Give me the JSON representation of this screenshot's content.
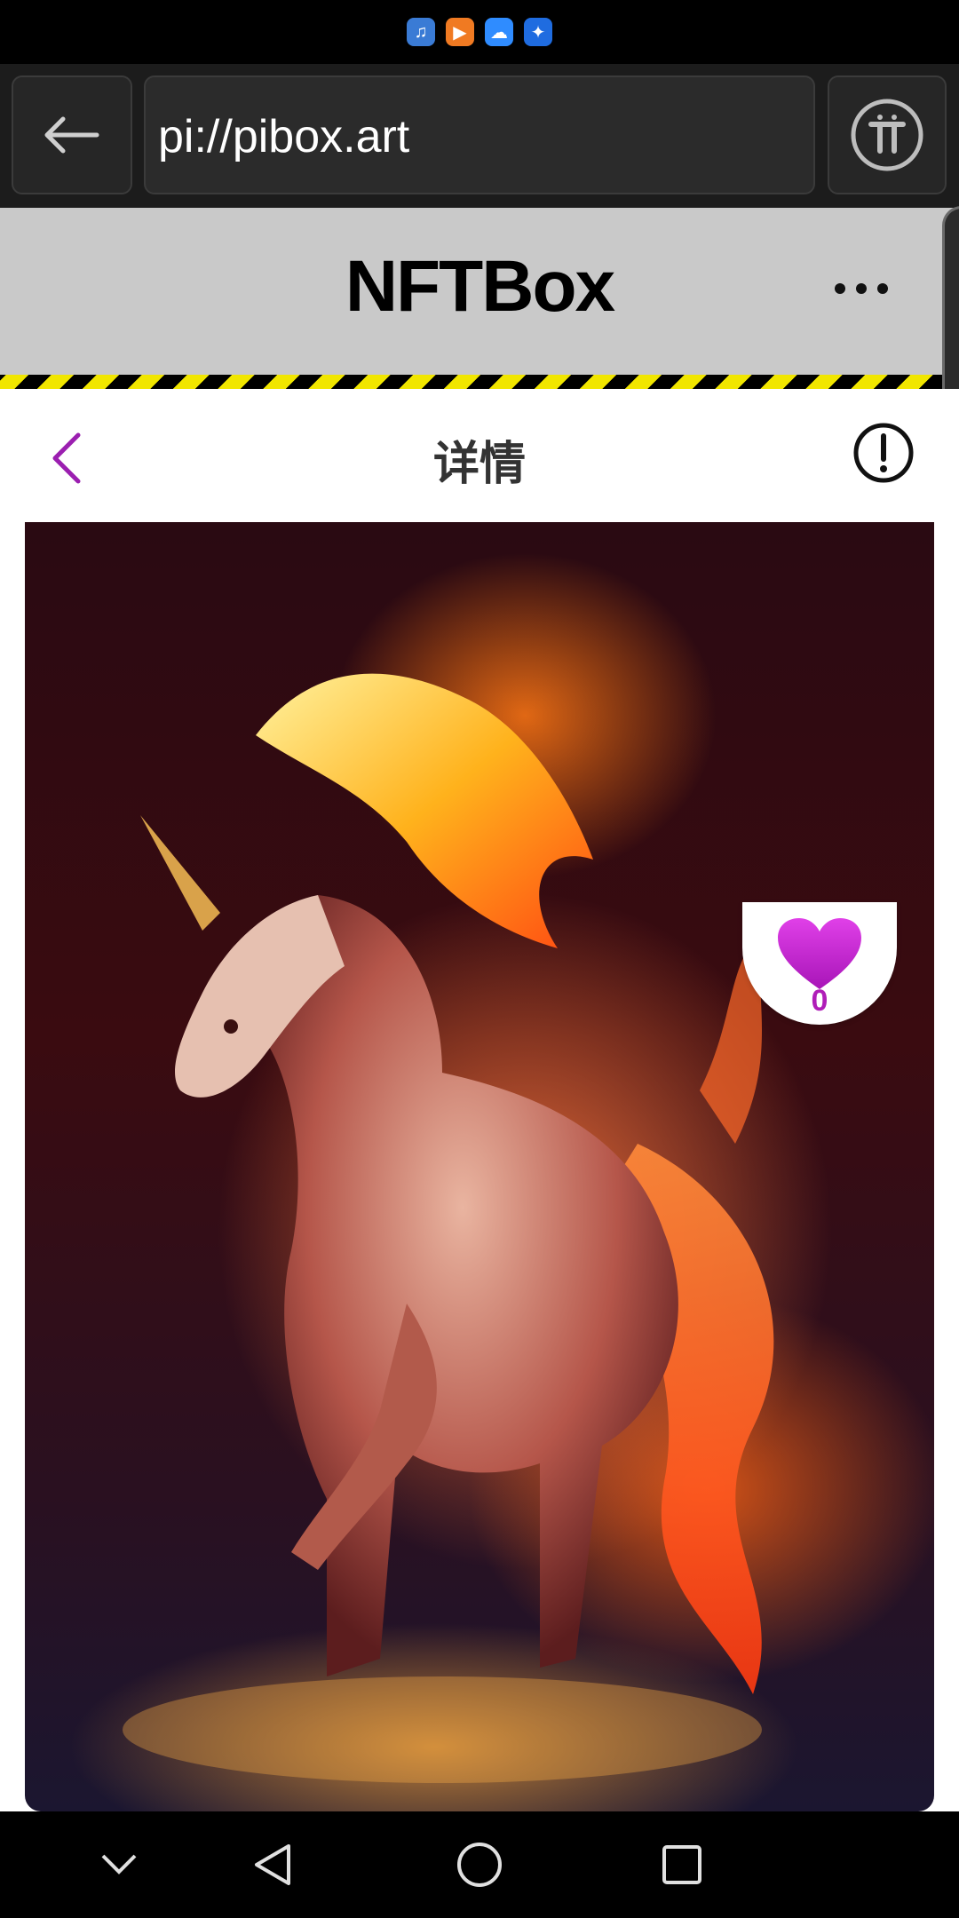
{
  "status_bar": {
    "icons": [
      "music-app-icon",
      "video-app-icon",
      "cloud-app-icon",
      "tips-app-icon"
    ],
    "icon_colors": [
      "#3a7bd5",
      "#f07a22",
      "#2f8cff",
      "#1f6ce0"
    ]
  },
  "browser": {
    "url": "pi://pibox.art",
    "back_icon": "arrow-left-icon",
    "pi_icon": "pi-logo-icon"
  },
  "app_header": {
    "title": "NFTBox",
    "more_icon": "more-dots-icon"
  },
  "detail": {
    "title": "详情",
    "back_icon": "chevron-left-icon",
    "info_icon": "info-exclamation-icon",
    "accent_color": "#9b1fb0"
  },
  "artwork": {
    "like_count": "0",
    "heart_color": "#c21fd0"
  },
  "system_nav": {
    "icons": [
      "collapse-chevron-icon",
      "back-triangle-icon",
      "home-circle-icon",
      "recents-square-icon"
    ]
  }
}
